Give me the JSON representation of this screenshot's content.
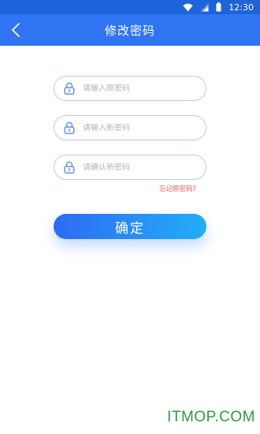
{
  "status_bar": {
    "time": "12:30",
    "icons": [
      "wifi-icon",
      "signal-icon",
      "battery-icon"
    ]
  },
  "header": {
    "title": "修改密码",
    "back_icon": "chevron-left-icon"
  },
  "form": {
    "old_password": {
      "placeholder": "请输入原密码",
      "value": ""
    },
    "new_password": {
      "placeholder": "请输入新密码",
      "value": ""
    },
    "confirm_password": {
      "placeholder": "请确认新密码",
      "value": ""
    },
    "field_icon": "lock-icon",
    "forgot_link": "忘记原密码?",
    "submit_label": "确定"
  },
  "watermark": "ITMOP.COM",
  "colors": {
    "header": "#2f75f3",
    "status_bar": "#1f63d8",
    "field_border": "#b5cdef",
    "forgot_link": "#ee5b55",
    "button_gradient_start": "#2f6af2",
    "button_gradient_end": "#22aef8",
    "watermark": "#2f9a3a"
  }
}
